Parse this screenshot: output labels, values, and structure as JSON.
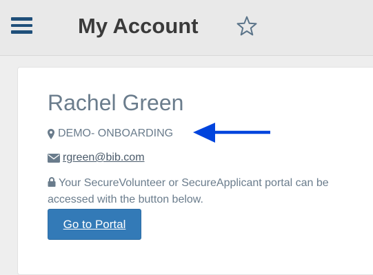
{
  "header": {
    "title": "My Account",
    "menu_icon": "hamburger-menu-icon",
    "favorite_icon": "star-outline-icon",
    "accent_color": "#1f4f7a"
  },
  "profile": {
    "name": "Rachel Green",
    "organization": "DEMO- ONBOARDING",
    "organization_icon": "map-marker-icon",
    "email": "rgreen@bib.com",
    "email_icon": "envelope-icon",
    "portal_note": "Your SecureVolunteer or SecureApplicant portal can be accessed with the button below.",
    "portal_note_icon": "lock-icon",
    "portal_button_label": "Go to Portal",
    "portal_button_color": "#337ab7"
  },
  "annotation": {
    "arrow_color": "#0044dd"
  }
}
